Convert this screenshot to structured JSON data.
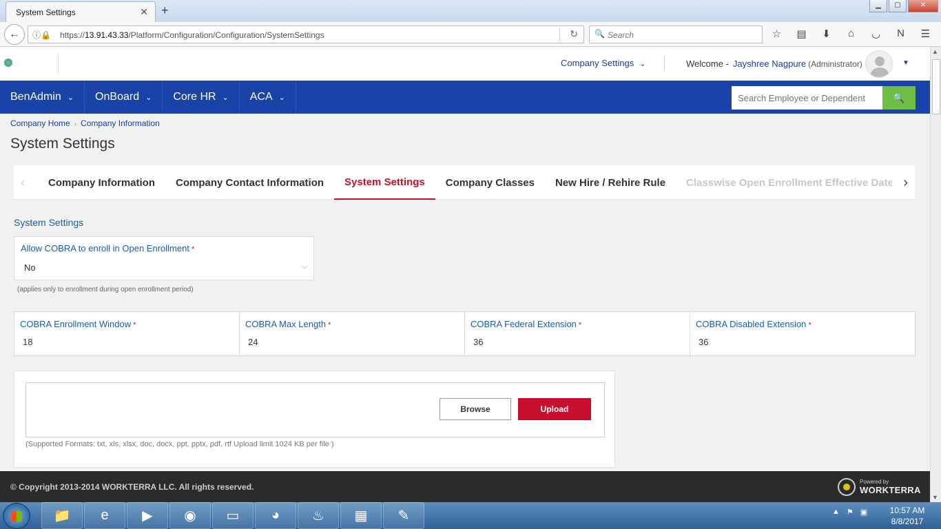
{
  "browser": {
    "tab_title": "System Settings",
    "tab_close": "✕",
    "new_tab": "+",
    "url_prefix": "https://",
    "url_host": "13.91.43.33",
    "url_path": "/Platform/Configuration/Configuration/SystemSettings",
    "search_placeholder": "Search"
  },
  "header": {
    "company_settings": "Company Settings",
    "welcome": "Welcome -",
    "user_name": "Jayshree Nagpure",
    "user_role": "(Administrator)"
  },
  "nav": {
    "menus": [
      {
        "label": "BenAdmin"
      },
      {
        "label": "OnBoard"
      },
      {
        "label": "Core HR"
      },
      {
        "label": "ACA"
      }
    ],
    "search_placeholder": "Search Employee or Dependent"
  },
  "breadcrumb": {
    "home": "Company Home",
    "current": "Company Information"
  },
  "page_title": "System Settings",
  "tabs": [
    {
      "label": "Company Information",
      "state": "normal"
    },
    {
      "label": "Company Contact Information",
      "state": "normal"
    },
    {
      "label": "System Settings",
      "state": "active"
    },
    {
      "label": "Company Classes",
      "state": "normal"
    },
    {
      "label": "New Hire / Rehire Rule",
      "state": "normal"
    },
    {
      "label": "Classwise Open Enrollment Effective Date",
      "state": "faded"
    }
  ],
  "form": {
    "section_title": "System Settings",
    "cobra_open_enrollment": {
      "label": "Allow COBRA to enroll in Open Enrollment",
      "value": "No",
      "hint": "(applies only to enrollment during open enrollment period)"
    },
    "cobra_fields": [
      {
        "label": "COBRA Enrollment Window",
        "value": "18"
      },
      {
        "label": "COBRA Max Length",
        "value": "24"
      },
      {
        "label": "COBRA Federal Extension",
        "value": "36"
      },
      {
        "label": "COBRA Disabled Extension",
        "value": "36"
      }
    ],
    "required_mark": "*"
  },
  "upload": {
    "browse_label": "Browse",
    "upload_label": "Upload",
    "formats_text": "(Supported Formats: txt, xls, xlsx, doc, docx, ppt, pptx, pdf, rtf Upload limit 1024 KB per file )"
  },
  "footer": {
    "copyright": "© Copyright 2013-2014 WORKTERRA LLC. All rights reserved.",
    "powered_by": "Powered by",
    "brand": "WORKTERRA"
  },
  "taskbar": {
    "time": "10:57 AM",
    "date": "8/8/2017"
  },
  "colors": {
    "nav_blue": "#1a43a8",
    "accent_red": "#c8102e",
    "search_green": "#6fbe44",
    "footer_dark": "#2b2b2b"
  }
}
